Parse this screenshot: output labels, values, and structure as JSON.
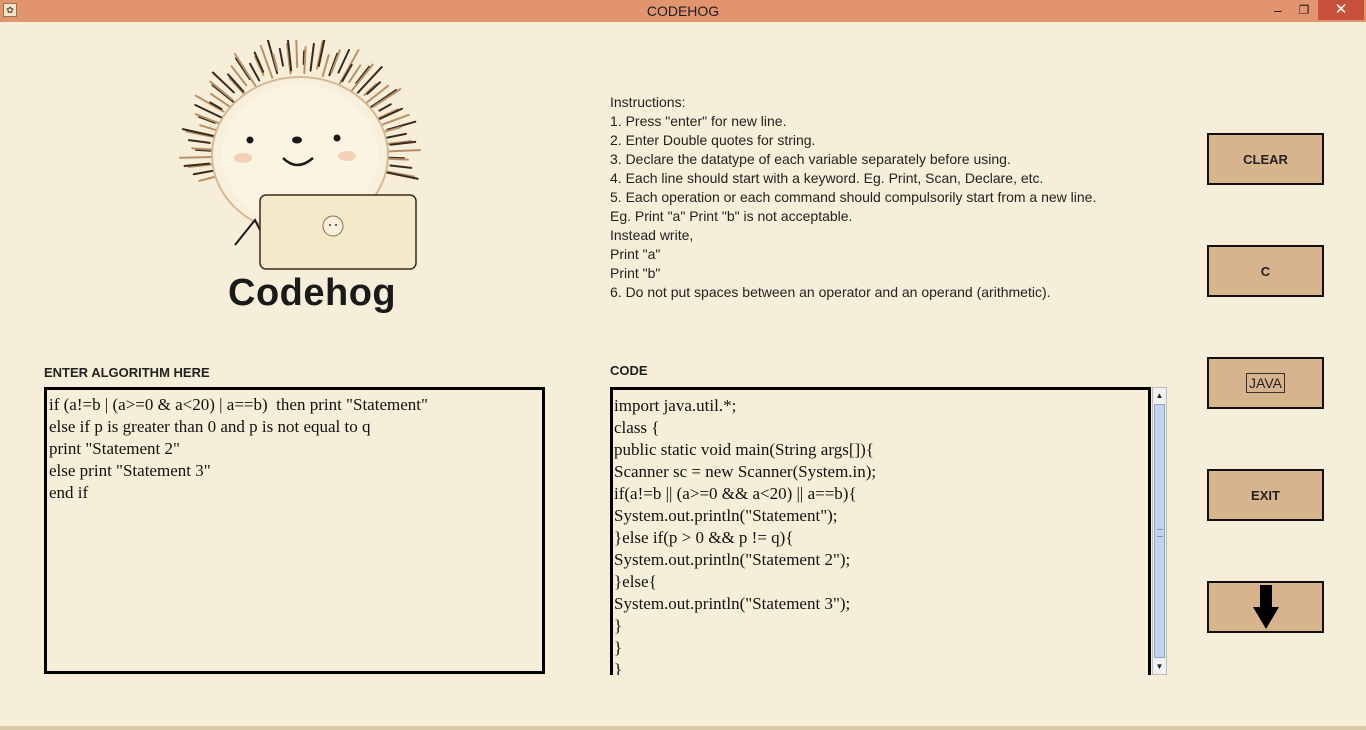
{
  "window": {
    "title": "CODEHOG",
    "minimize": "–",
    "maximize": "❐",
    "close": "✕",
    "app_icon": "hedgehog-app-icon"
  },
  "logo": {
    "text": "Codehog",
    "image": "hedgehog-with-laptop"
  },
  "instructions": [
    "Instructions:",
    "1. Press \"enter\" for new line.",
    "2. Enter Double quotes for string.",
    "3. Declare the datatype of each variable separately before using.",
    "4. Each line should start with a keyword. Eg. Print, Scan, Declare, etc.",
    "5. Each operation or each command should compulsorily start from a new line.",
    "Eg. Print \"a\" Print \"b\" is not acceptable.",
    "Instead write,",
    "Print \"a\"",
    "Print \"b\"",
    "6. Do not put spaces between an operator and an operand (arithmetic)."
  ],
  "algorithm": {
    "label": "ENTER ALGORITHM HERE",
    "lines": [
      "if (a!=b | (a>=0 & a<20) | a==b)  then print \"Statement\"",
      "else if p is greater than 0 and p is not equal to q",
      "print \"Statement 2\"",
      "else print \"Statement 3\"",
      "end if"
    ]
  },
  "code": {
    "label": "CODE",
    "lines": [
      "import java.util.*;",
      "class {",
      "public static void main(String args[]){",
      "Scanner sc = new Scanner(System.in);",
      "if(a!=b || (a>=0 && a<20) || a==b){",
      "System.out.println(\"Statement\");",
      "}else if(p > 0 && p != q){",
      "System.out.println(\"Statement 2\");",
      "}else{",
      "System.out.println(\"Statement 3\");",
      "}",
      "}",
      "}"
    ],
    "scroll_up": "▲",
    "scroll_down": "▼"
  },
  "buttons": {
    "clear": "CLEAR",
    "c": "C",
    "java": "JAVA",
    "exit": "EXIT",
    "download_icon": "arrow-down-icon"
  },
  "colors": {
    "background": "#f6eed8",
    "titlebar": "#e2946e",
    "button": "#d8b48e"
  }
}
